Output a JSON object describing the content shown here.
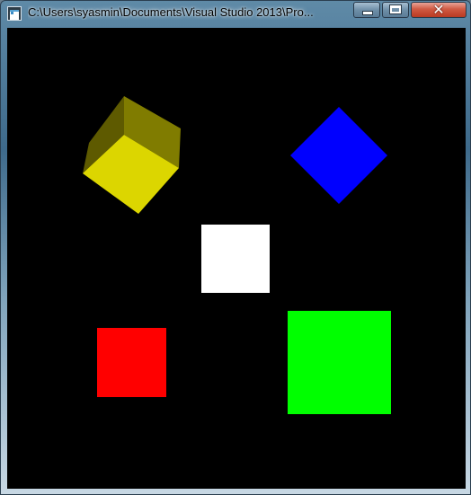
{
  "window": {
    "title": "C:\\Users\\syasmin\\Documents\\Visual Studio 2013\\Pro...",
    "controls": {
      "minimize": "minimize",
      "maximize": "maximize",
      "close": "close"
    }
  },
  "scene": {
    "background_color": "#000000",
    "shapes": [
      {
        "name": "yellow-cube",
        "kind": "cube",
        "colors": {
          "front": "#dcd600",
          "top": "#807c00",
          "side": "#5e5a00"
        }
      },
      {
        "name": "blue-diamond",
        "kind": "square rotated 45°",
        "color": "#0000ff"
      },
      {
        "name": "white-square",
        "kind": "square",
        "color": "#ffffff"
      },
      {
        "name": "red-square",
        "kind": "square",
        "color": "#ff0000"
      },
      {
        "name": "green-square",
        "kind": "square",
        "color": "#00ff00"
      }
    ]
  }
}
